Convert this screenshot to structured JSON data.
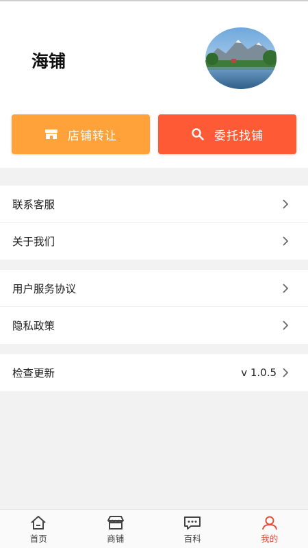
{
  "header": {
    "title": "海铺"
  },
  "actions": {
    "transfer_label": "店铺转让",
    "find_label": "委托找铺"
  },
  "menu": {
    "contact": "联系客服",
    "about": "关于我们",
    "agreement": "用户服务协议",
    "privacy": "隐私政策",
    "update": "检查更新",
    "version": "v 1.0.5"
  },
  "tabs": [
    {
      "label": "首页",
      "icon": "home-icon"
    },
    {
      "label": "商铺",
      "icon": "store-icon"
    },
    {
      "label": "百科",
      "icon": "chat-icon"
    },
    {
      "label": "我的",
      "icon": "user-icon"
    }
  ],
  "colors": {
    "transfer": "#ffa23a",
    "find": "#ff5a36",
    "active_tab": "#e0513a"
  }
}
